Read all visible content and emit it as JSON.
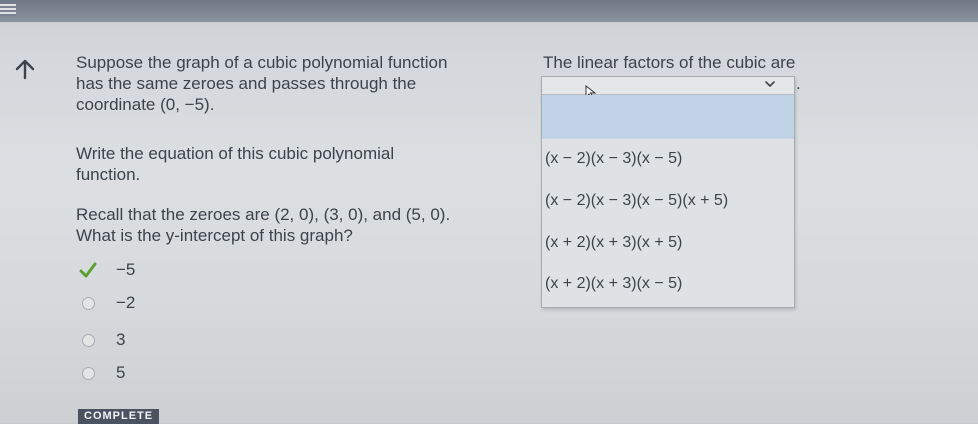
{
  "question": {
    "intro_line1": "Suppose the graph of a cubic polynomial function",
    "intro_line2": "has the same zeroes and passes through the",
    "intro_line3": "coordinate (0, −5).",
    "task_line1": "Write the equation of this cubic polynomial",
    "task_line2": "function.",
    "recall": "Recall that the zeroes are (2, 0), (3, 0), and (5, 0).",
    "prompt": "What is the y-intercept of this graph?"
  },
  "answers": [
    {
      "label": "−5",
      "selected": true
    },
    {
      "label": "−2",
      "selected": false
    },
    {
      "label": "3",
      "selected": false
    },
    {
      "label": "5",
      "selected": false
    }
  ],
  "status_badge": "COMPLETE",
  "linear_factors": {
    "title": "The linear factors of the cubic are",
    "trailing_period": ".",
    "options": [
      "(x − 2)(x − 3)(x − 5)",
      "(x − 2)(x − 3)(x − 5)(x + 5)",
      "(x + 2)(x + 3)(x + 5)",
      "(x + 2)(x + 3)(x − 5)"
    ]
  },
  "colors": {
    "check_green": "#5aa031",
    "dropdown_highlight": "#c1d3e6",
    "badge_bg": "#4b5260"
  },
  "icons": {
    "back": "back-arrow-icon",
    "check": "check-icon",
    "dropdown": "chevron-down-icon",
    "cursor": "mouse-cursor-icon"
  }
}
